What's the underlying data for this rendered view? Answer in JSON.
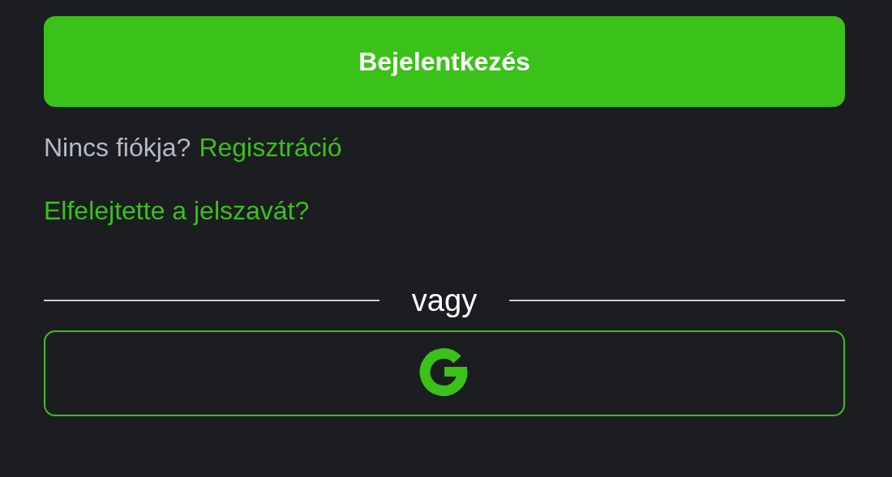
{
  "login_button": {
    "label": "Bejelentkezés"
  },
  "register_prompt": {
    "text": "Nincs fiókja?",
    "link": "Regisztráció"
  },
  "forgot_password_link": "Elfelejtette a jelszavát?",
  "divider_text": "vagy",
  "social_buttons": [
    {
      "kind": "google"
    }
  ]
}
